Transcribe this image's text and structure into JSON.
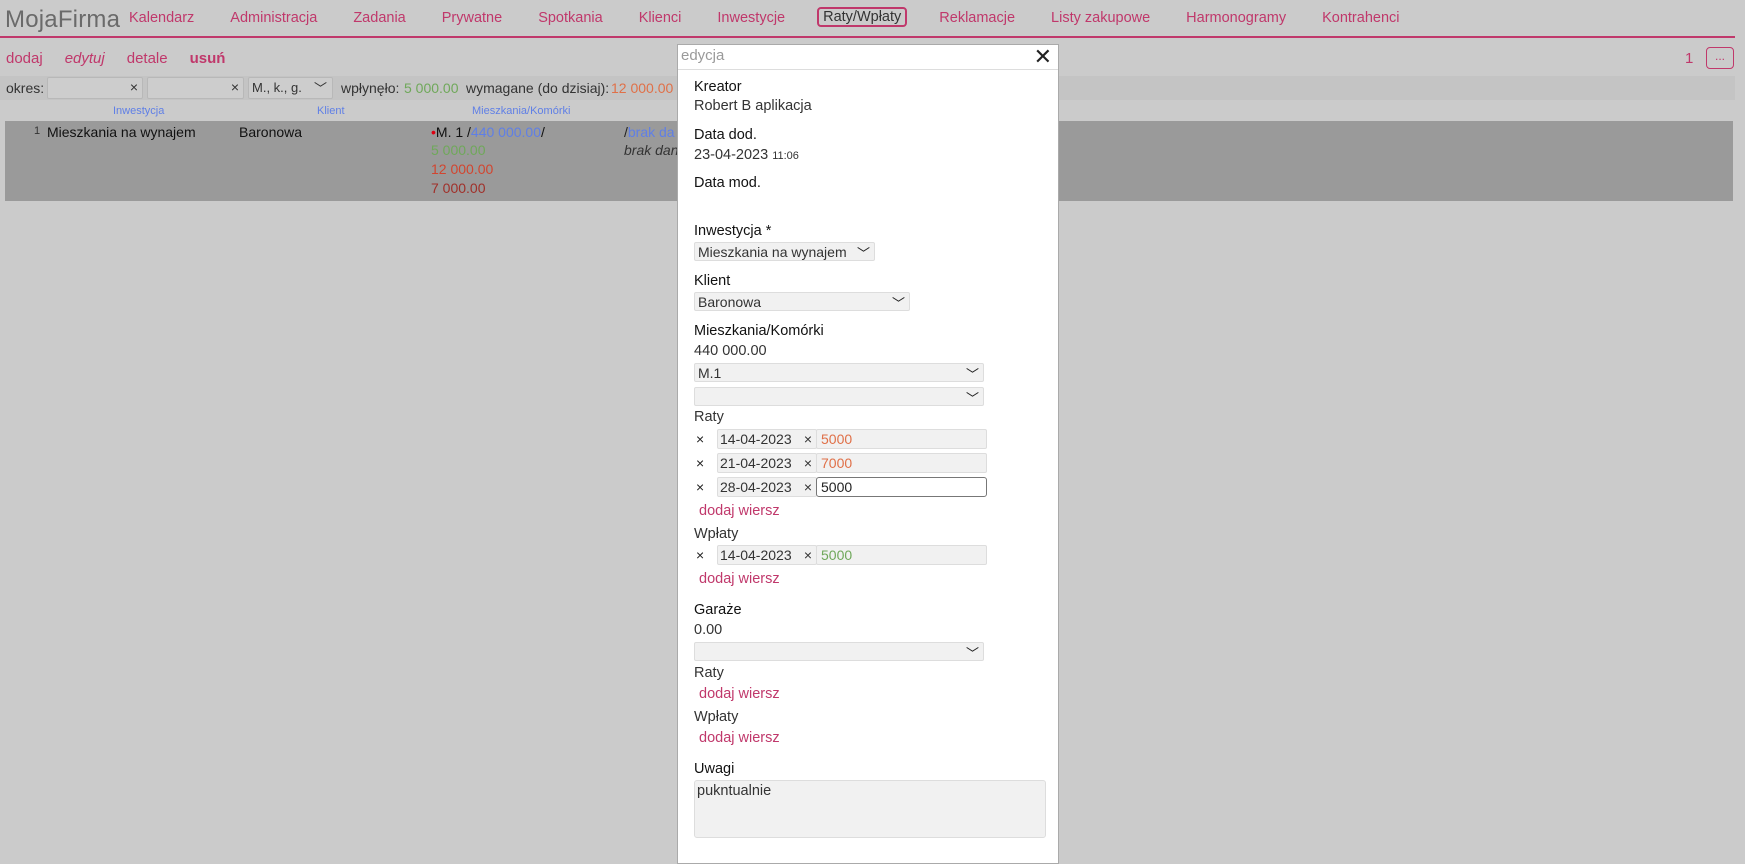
{
  "header": {
    "app_title": "MojaFirma",
    "nav": [
      "Kalendarz",
      "Administracja",
      "Zadania",
      "Prywatne",
      "Spotkania",
      "Klienci",
      "Inwestycje",
      "Raty/Wpłaty",
      "Reklamacje",
      "Listy zakupowe",
      "Harmonogramy",
      "Kontrahenci"
    ],
    "active_nav": "Raty/Wpłaty"
  },
  "actions": {
    "add": "dodaj",
    "edit": "edytuj",
    "details": "detale",
    "delete": "usuń"
  },
  "pagination": {
    "page": "1",
    "more": "..."
  },
  "filter": {
    "period_label": "okres:",
    "period_from": "",
    "period_to": "",
    "clear": "×",
    "range_select": "M., k., g.",
    "paid_label": "wpłynęło:",
    "paid_value": "5 000.00",
    "required_label": "wymagane (do dzisiaj):",
    "required_value": "12 000.00"
  },
  "table": {
    "columns": [
      "Inwestycja",
      "Klient",
      "Mieszkania/Komórki"
    ],
    "rows": [
      {
        "num": "1",
        "investment": "Mieszkania na wynajem",
        "client": "Baronowa",
        "unit_prefix": "•",
        "unit": "M. 1",
        "unit_sep1": "/",
        "unit_price": "440 000.00",
        "unit_sep2": "/",
        "paid": "5 000.00",
        "required": "12 000.00",
        "rest": "7 000.00",
        "extra_sep": "/",
        "extra_link": "brak da",
        "extra_note": "brak dan"
      }
    ]
  },
  "modal": {
    "title": "edycja",
    "close": "✕",
    "creator_label": "Kreator",
    "creator": "Robert B aplikacja",
    "date_added_label": "Data dod.",
    "date_added": "23-04-2023",
    "time_added": "11:06",
    "date_mod_label": "Data mod.",
    "investment_label": "Inwestycja *",
    "investment": "Mieszkania na wynajem",
    "client_label": "Klient",
    "client": "Baronowa",
    "units_label": "Mieszkania/Komórki",
    "units_total": "440 000.00",
    "unit_select": "M.1",
    "unit_select2": "",
    "installments_label": "Raty",
    "installments": [
      {
        "date": "14-04-2023",
        "amount": "5000"
      },
      {
        "date": "21-04-2023",
        "amount": "7000"
      },
      {
        "date": "28-04-2023",
        "amount": "5000"
      }
    ],
    "add_row": "dodaj wiersz",
    "payments_label": "Wpłaty",
    "payments": [
      {
        "date": "14-04-2023",
        "amount": "5000"
      }
    ],
    "garages_label": "Garaże",
    "garages_total": "0.00",
    "garage_select": "",
    "garage_installments_label": "Raty",
    "garage_payments_label": "Wpłaty",
    "notes_label": "Uwagi",
    "notes": "pukntualnie",
    "remove": "×"
  },
  "colors": {
    "accent": "#c0386b",
    "blue": "#5f7fe6",
    "green": "#6fa85a",
    "orange": "#e07048"
  }
}
